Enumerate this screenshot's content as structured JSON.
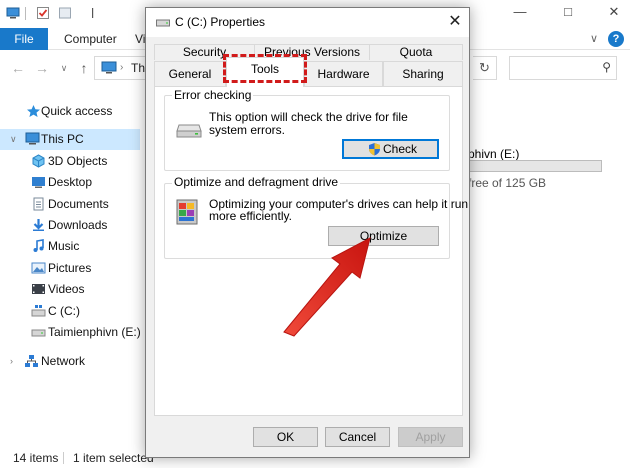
{
  "explorer": {
    "ribbon": {
      "file": "File",
      "computer": "Computer",
      "view": "Vie"
    },
    "address": {
      "text": "Thi"
    },
    "nav": {
      "quick_access": "Quick access",
      "this_pc": "This PC",
      "items": [
        "3D Objects",
        "Desktop",
        "Documents",
        "Downloads",
        "Music",
        "Pictures",
        "Videos",
        "C (C:)",
        "Taimienphivn (E:)"
      ],
      "network": "Network"
    },
    "drive": {
      "name": "phivn (E:)",
      "free": "free of 125 GB",
      "used_fraction": 0.0
    },
    "status": {
      "items": "14 items",
      "selected": "1 item selected"
    }
  },
  "dialog": {
    "title": "C (C:) Properties",
    "tabs_row1": [
      "Security",
      "Previous Versions",
      "Quota"
    ],
    "tabs_row2": [
      "General",
      "Tools",
      "Hardware",
      "Sharing"
    ],
    "active_tab": "Tools",
    "error_checking": {
      "title": "Error checking",
      "description_line1": "This option will check the drive for file",
      "description_line2": "system errors.",
      "button": "Check"
    },
    "optimize": {
      "title": "Optimize and defragment drive",
      "description_line1": "Optimizing your computer's drives can help it run",
      "description_line2": "more efficiently.",
      "button": "Optimize"
    },
    "buttons": {
      "ok": "OK",
      "cancel": "Cancel",
      "apply": "Apply"
    }
  },
  "colors": {
    "accent": "#1979ca",
    "selection": "#cce8ff",
    "highlight_red": "#d11b1b",
    "arrow_red": "#e8221f"
  }
}
